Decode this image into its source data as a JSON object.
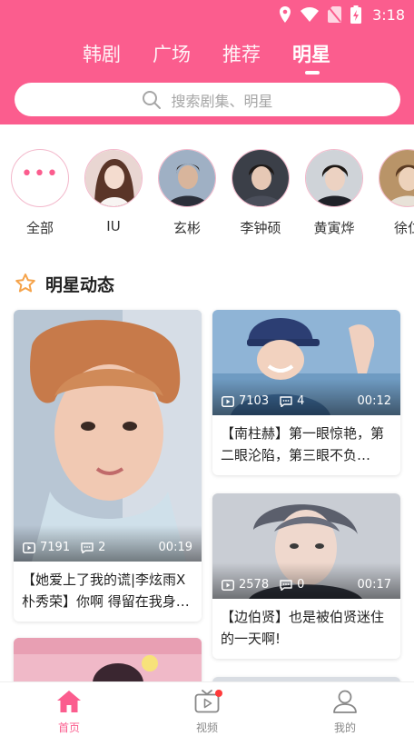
{
  "status_bar": {
    "time": "3:18"
  },
  "header": {
    "tabs": [
      {
        "label": "韩剧"
      },
      {
        "label": "广场"
      },
      {
        "label": "推荐"
      },
      {
        "label": "明星",
        "active": true
      }
    ],
    "search": {
      "placeholder": "搜索剧集、明星"
    }
  },
  "stars": [
    {
      "name": "全部",
      "icon": "more-dots-icon"
    },
    {
      "name": "IU"
    },
    {
      "name": "玄彬"
    },
    {
      "name": "李钟硕"
    },
    {
      "name": "黄寅烨"
    },
    {
      "name": "徐仁"
    }
  ],
  "section": {
    "title": "明星动态",
    "icon": "star-outline-icon"
  },
  "cards": [
    {
      "views": "7191",
      "comments": "2",
      "duration": "00:19",
      "title": "【她爱上了我的谎|李炫雨X朴秀荣】你啊 得留在我身…"
    },
    {
      "views": "7103",
      "comments": "4",
      "duration": "00:12",
      "title": "【南柱赫】第一眼惊艳，第二眼沦陷，第三眼不负…"
    },
    {
      "views": "2578",
      "comments": "0",
      "duration": "00:17",
      "title": "【边伯贤】也是被伯贤迷住的一天啊!"
    }
  ],
  "bottom_nav": [
    {
      "label": "首页",
      "icon": "home-icon",
      "active": true
    },
    {
      "label": "视频",
      "icon": "tv-icon",
      "badge": true
    },
    {
      "label": "我的",
      "icon": "user-icon"
    }
  ],
  "colors": {
    "accent": "#fb5d8e",
    "badge": "#ff3b3b"
  }
}
